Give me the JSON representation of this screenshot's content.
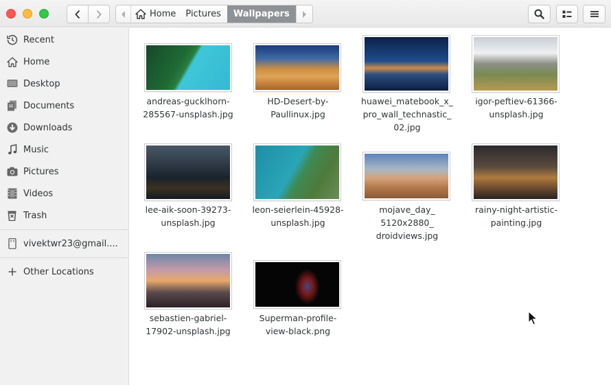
{
  "window": {
    "controls": [
      "close",
      "minimize",
      "maximize"
    ]
  },
  "toolbar": {
    "back_icon": "chevron-left-icon",
    "forward_icon": "chevron-right-icon",
    "search_icon": "search-icon",
    "view_icon": "list-view-icon",
    "menu_icon": "hamburger-menu-icon"
  },
  "pathbar": {
    "crumbs": [
      {
        "label": "Home",
        "icon": "home-icon"
      },
      {
        "label": "Pictures"
      },
      {
        "label": "Wallpapers",
        "active": true
      }
    ]
  },
  "sidebar": {
    "items": [
      {
        "label": "Recent",
        "icon": "recent-icon"
      },
      {
        "label": "Home",
        "icon": "home-icon"
      },
      {
        "label": "Desktop",
        "icon": "desktop-icon"
      },
      {
        "label": "Documents",
        "icon": "documents-icon"
      },
      {
        "label": "Downloads",
        "icon": "downloads-icon"
      },
      {
        "label": "Music",
        "icon": "music-icon"
      },
      {
        "label": "Pictures",
        "icon": "pictures-icon"
      },
      {
        "label": "Videos",
        "icon": "videos-icon"
      },
      {
        "label": "Trash",
        "icon": "trash-icon"
      }
    ],
    "account": {
      "label": "vivektwr23@gmail....",
      "icon": "drive-icon"
    },
    "other": {
      "label": "Other Locations",
      "icon": "plus-icon"
    }
  },
  "files": [
    {
      "line1": "andreas-gucklhorn-",
      "line2": "285567-unsplash.jpg",
      "line3": ""
    },
    {
      "line1": "HD-Desert-by-",
      "line2": "Paullinux.jpg",
      "line3": ""
    },
    {
      "line1": "huawei_matebook_x_",
      "line2": "pro_wall_technastic_",
      "line3": "02.jpg"
    },
    {
      "line1": "igor-peftiev-61366-",
      "line2": "unsplash.jpg",
      "line3": ""
    },
    {
      "line1": "lee-aik-soon-39273-",
      "line2": "unsplash.jpg",
      "line3": ""
    },
    {
      "line1": "leon-seierlein-45928-",
      "line2": "unsplash.jpg",
      "line3": ""
    },
    {
      "line1": "mojave_day_",
      "line2": "5120x2880_",
      "line3": "droidviews.jpg"
    },
    {
      "line1": "rainy-night-artistic-",
      "line2": "painting.jpg",
      "line3": ""
    },
    {
      "line1": "sebastien-gabriel-",
      "line2": "17902-unsplash.jpg",
      "line3": ""
    },
    {
      "line1": "Superman-profile-",
      "line2": "view-black.png",
      "line3": ""
    }
  ],
  "colors": {
    "active_crumb": "#8e9195",
    "sidebar_bg": "#f1f1f1",
    "close": "#fc5753",
    "minimize": "#fdbc40",
    "maximize": "#33c748"
  }
}
